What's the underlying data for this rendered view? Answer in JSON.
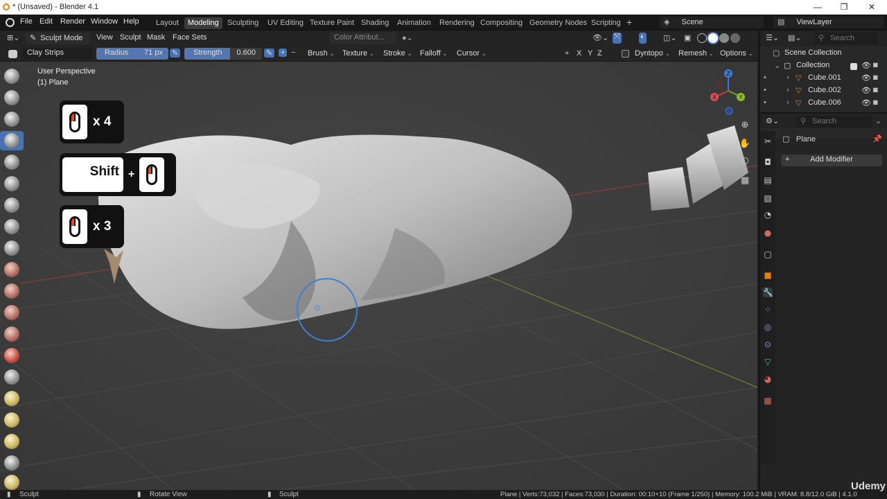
{
  "window": {
    "title": "* (Unsaved) - Blender 4.1",
    "minimize": "—",
    "maximize": "❐",
    "close": "✕"
  },
  "menu": [
    "File",
    "Edit",
    "Render",
    "Window",
    "Help"
  ],
  "workspaces": [
    "Layout",
    "Modeling",
    "Sculpting",
    "UV Editing",
    "Texture Paint",
    "Shading",
    "Animation",
    "Rendering",
    "Compositing",
    "Geometry Nodes",
    "Scripting"
  ],
  "active_workspace": "Modeling",
  "scene": {
    "label": "Scene"
  },
  "view_layer": {
    "label": "ViewLayer"
  },
  "header": {
    "mode": "Sculpt Mode",
    "view": "View",
    "sculpt": "Sculpt",
    "mask": "Mask",
    "face_sets": "Face Sets",
    "color_attribute": "Color Attribut..."
  },
  "tool_settings": {
    "brush_name": "Clay Strips",
    "radius_label": "Radius",
    "radius_value": "71 px",
    "strength_label": "Strength",
    "strength_value": "0.600",
    "brush": "Brush",
    "texture": "Texture",
    "stroke": "Stroke",
    "falloff": "Falloff",
    "cursor": "Cursor",
    "axis_x": "X",
    "axis_y": "Y",
    "axis_z": "Z",
    "dyntopo": "Dyntopo",
    "remesh": "Remesh",
    "options": "Options"
  },
  "viewport": {
    "perspective": "User Perspective",
    "object": "(1) Plane"
  },
  "overlay": {
    "clicks1": "x 4",
    "shift": "Shift",
    "plus": "+",
    "clicks3": "x 3"
  },
  "outliner": {
    "search_placeholder": "Search",
    "scene_collection": "Scene Collection",
    "collection": "Collection",
    "items": [
      "Cube.001",
      "Cube.002",
      "Cube.006"
    ]
  },
  "properties": {
    "search_placeholder": "Search",
    "object_name": "Plane",
    "add_modifier": "Add Modifier"
  },
  "gizmo": {
    "x": "X",
    "y": "Y",
    "z": "Z"
  },
  "statusbar": {
    "left_action": "Sculpt",
    "middle_action": "Rotate View",
    "right_action": "Sculpt",
    "stats": "Plane | Verts:73,032 | Faces:73,030 | Duration: 00:10+10 (Frame 1/250) | Memory: 100.2 MiB | VRAM: 8.8/12.0 GiB | 4.1.0"
  },
  "watermark": "Udemy",
  "colors": {
    "accent": "#4772b3",
    "object_orange": "#e87d0d",
    "mouse_red": "#e04a1c"
  }
}
